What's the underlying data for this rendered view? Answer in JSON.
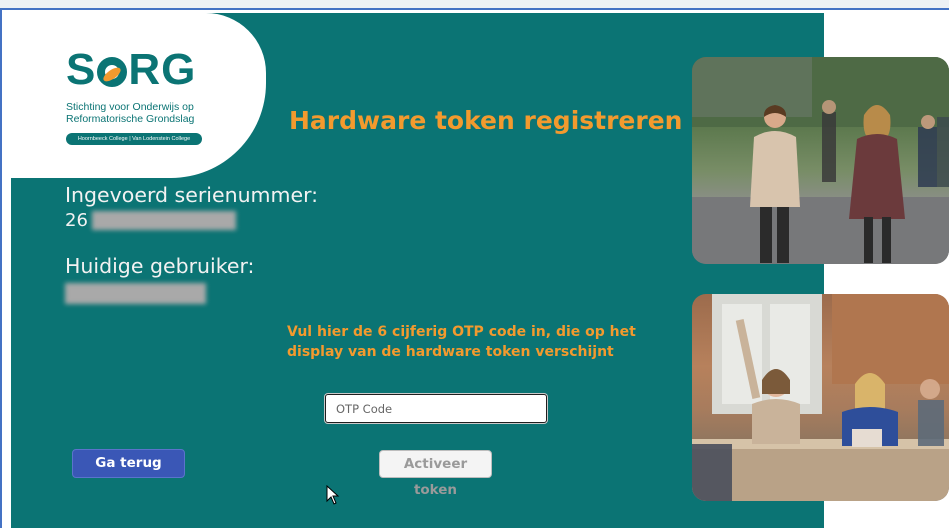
{
  "logo": {
    "word": "SORG",
    "subtitle_line1": "Stichting voor Onderwijs op",
    "subtitle_line2": "Reformatorische Grondslag",
    "colleges": "Hoornbeeck College | Van Lodenstein College"
  },
  "page": {
    "title": "Hardware token registreren",
    "serial_label": "Ingevoerd serienummer:",
    "serial_value_visible": "26",
    "user_label": "Huidige gebruiker:",
    "instruction": "Vul hier de 6 cijferig OTP code in, die op het display van de hardware token verschijnt"
  },
  "form": {
    "otp_placeholder": "OTP Code",
    "otp_value": "",
    "back_button": "Ga terug",
    "activate_button": "Activeer token"
  },
  "colors": {
    "brand_teal": "#0b7474",
    "accent_orange": "#f39a2e",
    "back_button_blue": "#3a57b6"
  },
  "icons": {
    "cursor": "mouse-pointer-icon"
  }
}
